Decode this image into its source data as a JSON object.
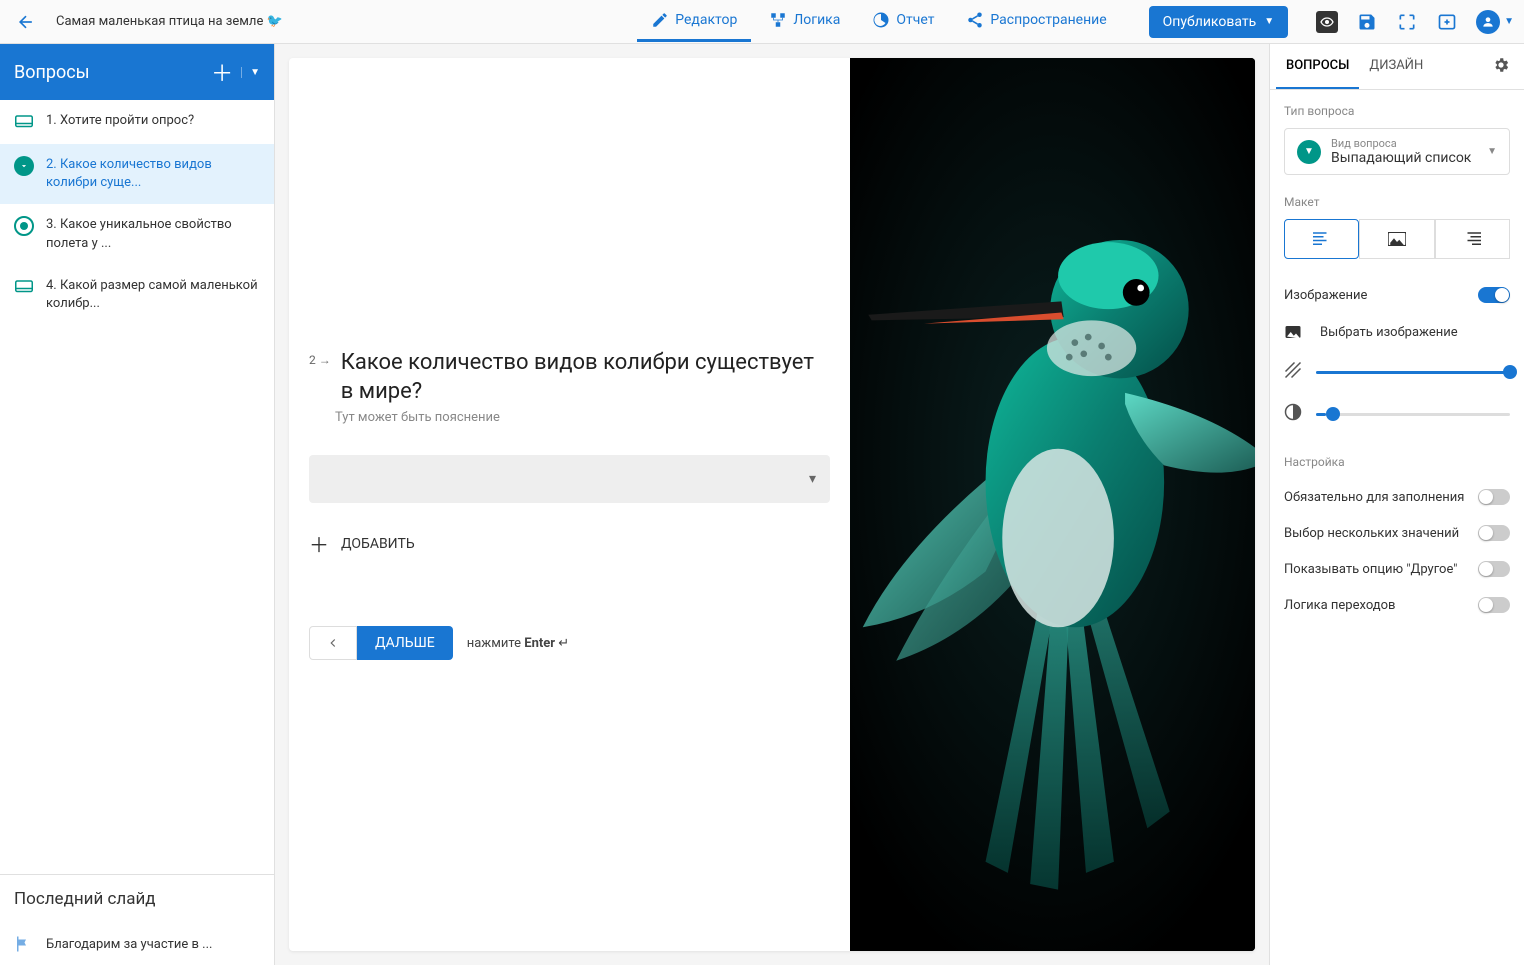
{
  "header": {
    "survey_title": "Самая маленькая птица на земле 🐦",
    "tabs": {
      "editor": "Редактор",
      "logic": "Логика",
      "report": "Отчет",
      "distribute": "Распространение"
    },
    "publish": "Опубликовать"
  },
  "sidebar": {
    "title": "Вопросы",
    "items": [
      {
        "label": "1. Хотите пройти опрос?",
        "icon": "form"
      },
      {
        "label": "2. Какое количество видов колибри суще...",
        "icon": "dropdown",
        "selected": true
      },
      {
        "label": "3. Какое уникальное свойство полета у ...",
        "icon": "radio"
      },
      {
        "label": "4. Какой размер самой маленькой колибр...",
        "icon": "form"
      }
    ],
    "last_slide_title": "Последний слайд",
    "last_slide_item": "Благодарим за участие в ..."
  },
  "preview": {
    "q_num": "2 →",
    "q_title": "Какое количество видов колибри существует в мире?",
    "q_desc": "Тут может быть пояснение",
    "add_option": "ДОБАВИТЬ",
    "next_btn": "ДАЛЬШЕ",
    "hint_prefix": "нажмите ",
    "hint_key": "Enter",
    "hint_suffix": " ↵"
  },
  "right": {
    "tabs": {
      "questions": "ВОПРОСЫ",
      "design": "ДИЗАЙН"
    },
    "section_type": "Тип вопроса",
    "type_small": "Вид вопроса",
    "type_main": "Выпадающий список",
    "section_layout": "Макет",
    "image_toggle": "Изображение",
    "pick_image": "Выбрать изображение",
    "section_settings": "Настройка",
    "settings": {
      "required": "Обязательно для заполнения",
      "multi": "Выбор нескольких значений",
      "other": "Показывать опцию \"Другое\"",
      "logic": "Логика переходов"
    },
    "sliders": {
      "opacity_percent": 100,
      "brightness_percent": 5
    }
  }
}
